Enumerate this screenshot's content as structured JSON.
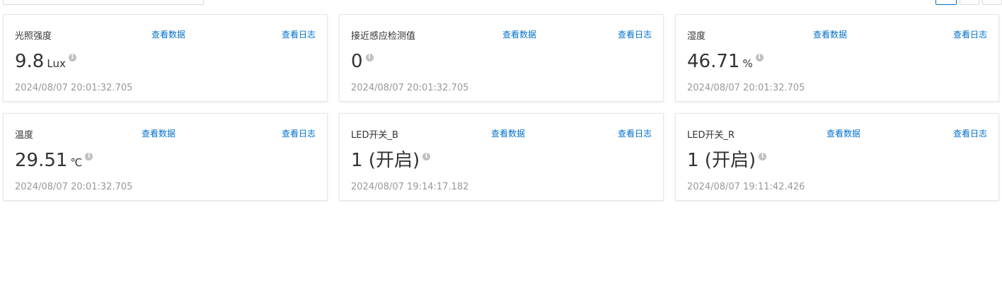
{
  "toolbar": {
    "search_placeholder": ""
  },
  "cards": [
    {
      "title": "光照强度",
      "data_link": "查看数据",
      "log_link": "查看日志",
      "value": "9.8",
      "unit": "Lux",
      "timestamp": "2024/08/07 20:01:32.705"
    },
    {
      "title": "接近感应检测值",
      "data_link": "查看数据",
      "log_link": "查看日志",
      "value": "0",
      "unit": "",
      "timestamp": "2024/08/07 20:01:32.705"
    },
    {
      "title": "湿度",
      "data_link": "查看数据",
      "log_link": "查看日志",
      "value": "46.71",
      "unit": "%",
      "timestamp": "2024/08/07 20:01:32.705"
    },
    {
      "title": "温度",
      "data_link": "查看数据",
      "log_link": "查看日志",
      "value": "29.51",
      "unit": "℃",
      "timestamp": "2024/08/07 20:01:32.705"
    },
    {
      "title": "LED开关_B",
      "data_link": "查看数据",
      "log_link": "查看日志",
      "value": "1 (开启)",
      "unit": "",
      "timestamp": "2024/08/07 19:14:17.182"
    },
    {
      "title": "LED开关_R",
      "data_link": "查看数据",
      "log_link": "查看日志",
      "value": "1 (开启)",
      "unit": "",
      "timestamp": "2024/08/07 19:11:42.426"
    }
  ],
  "info_icon_glyph": "i",
  "colors": {
    "link": "#0070cc",
    "timestamp": "#999999",
    "info_icon": "#c0c0c0"
  }
}
